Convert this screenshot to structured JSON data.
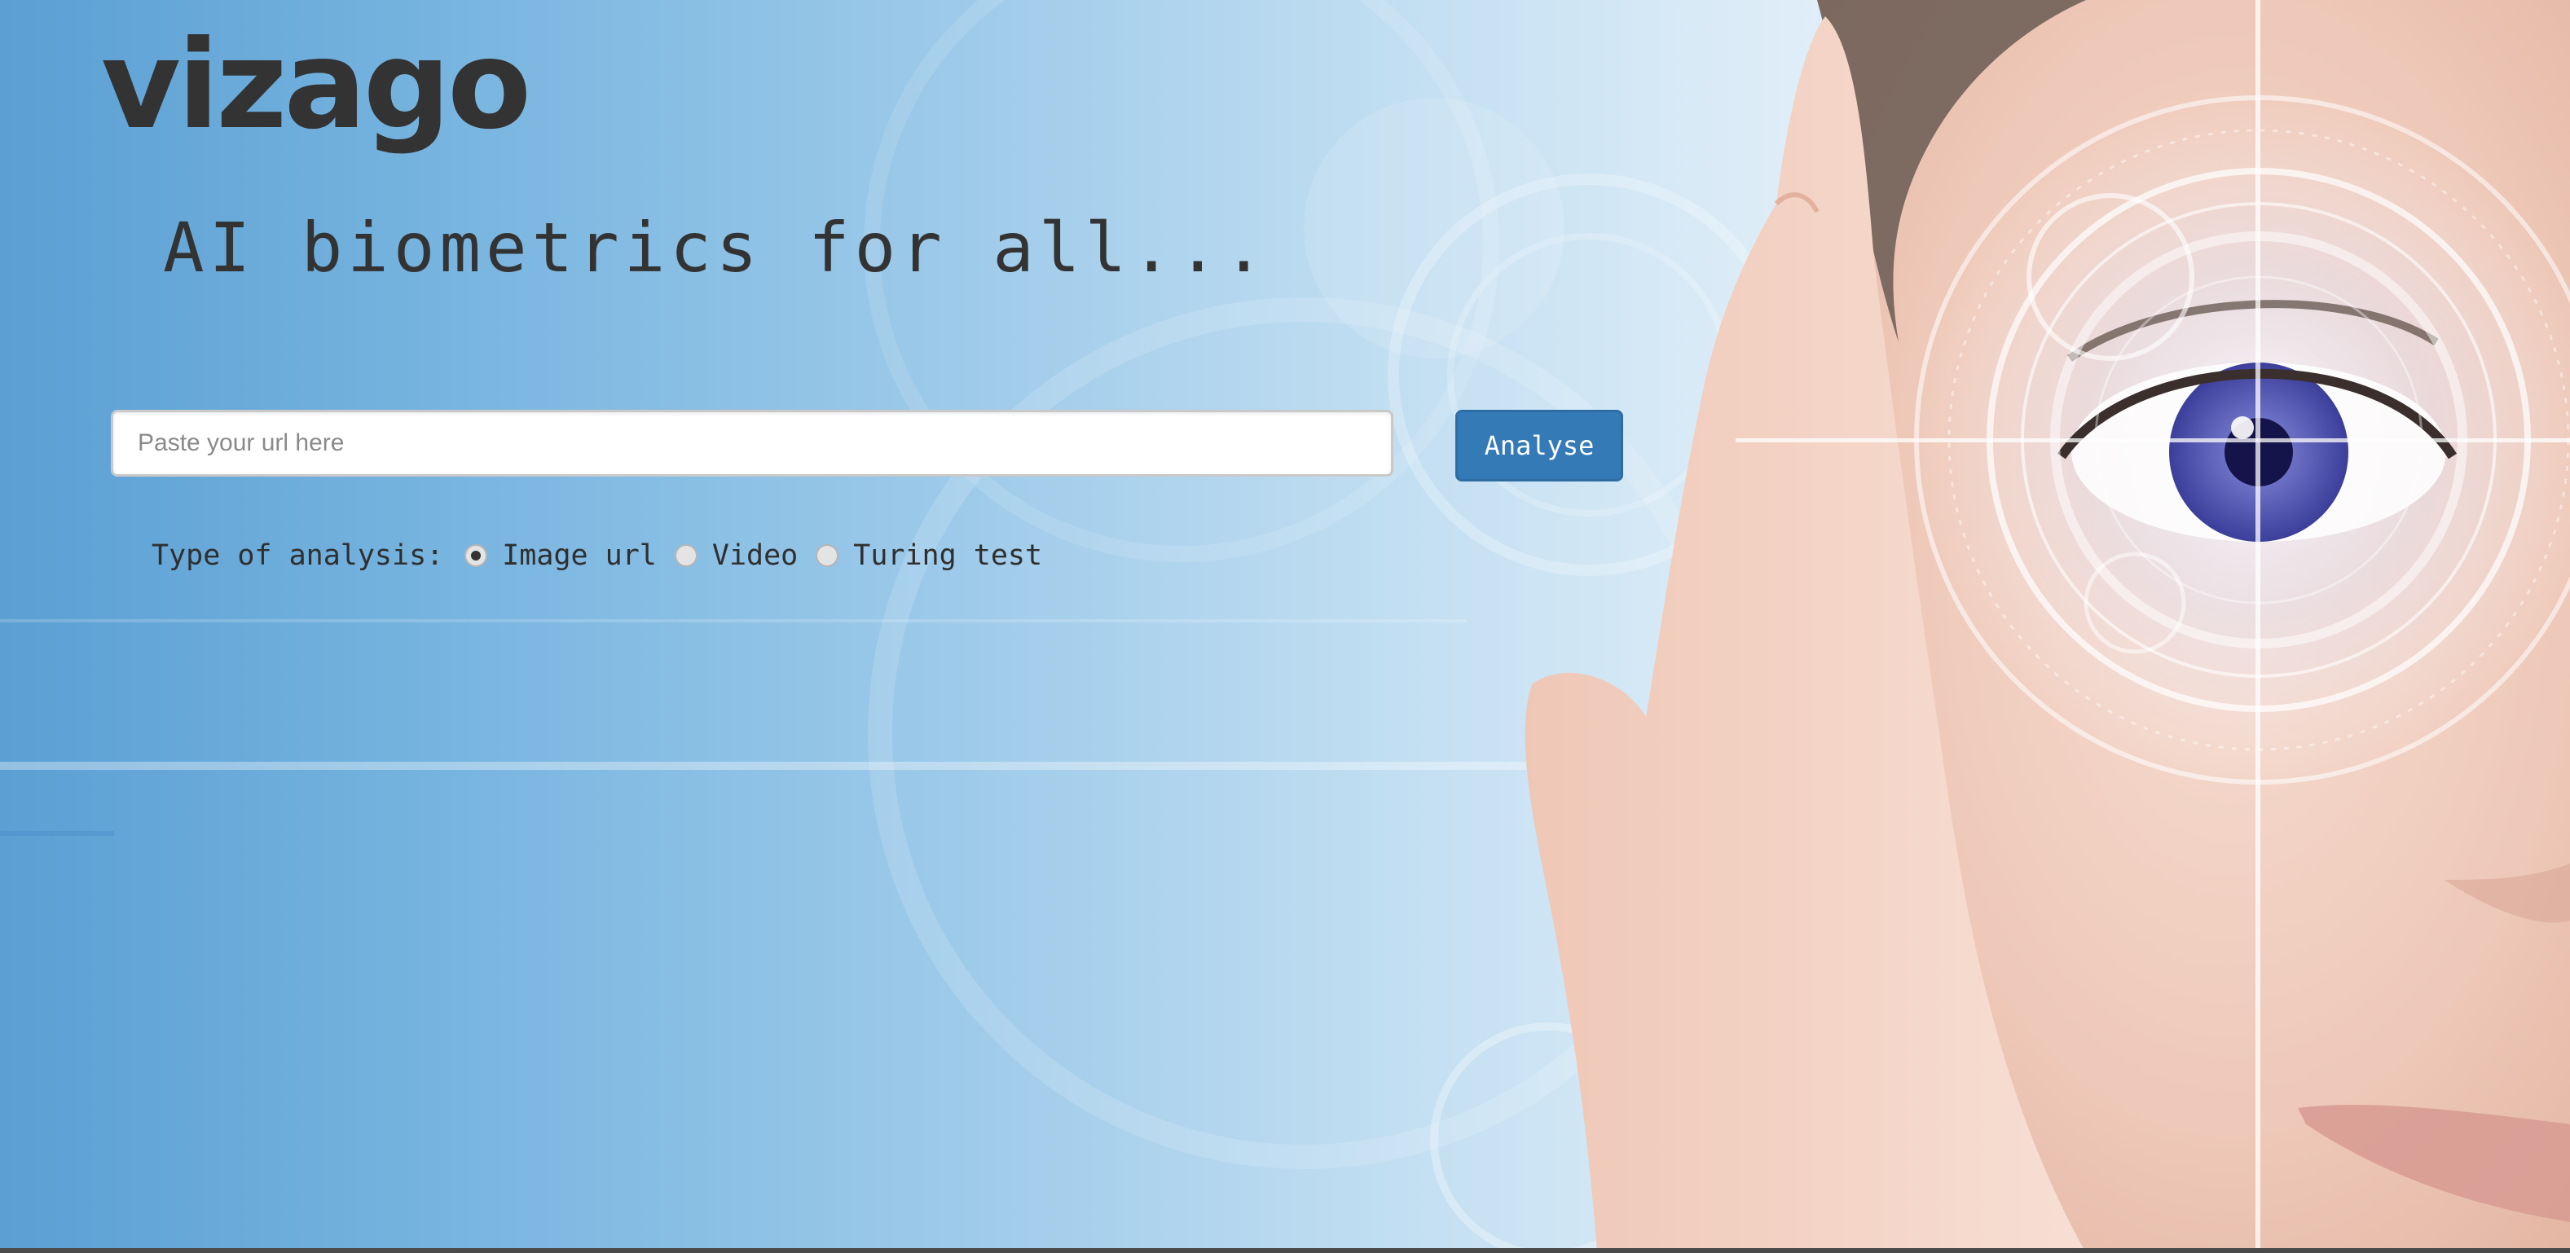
{
  "brand": {
    "logo": "vizago",
    "tagline": "AI biometrics for all..."
  },
  "search": {
    "placeholder": "Paste your url here",
    "value": "",
    "button_label": "Analyse"
  },
  "analysis": {
    "label": "Type of analysis:",
    "options": [
      {
        "label": "Image url",
        "selected": true
      },
      {
        "label": "Video",
        "selected": false
      },
      {
        "label": "Turing test",
        "selected": false
      }
    ]
  },
  "colors": {
    "button": "#337ab7",
    "text": "#333333",
    "background_blue": "#5b9fd3"
  },
  "hero_image": "woman-eye-biometric-scan"
}
